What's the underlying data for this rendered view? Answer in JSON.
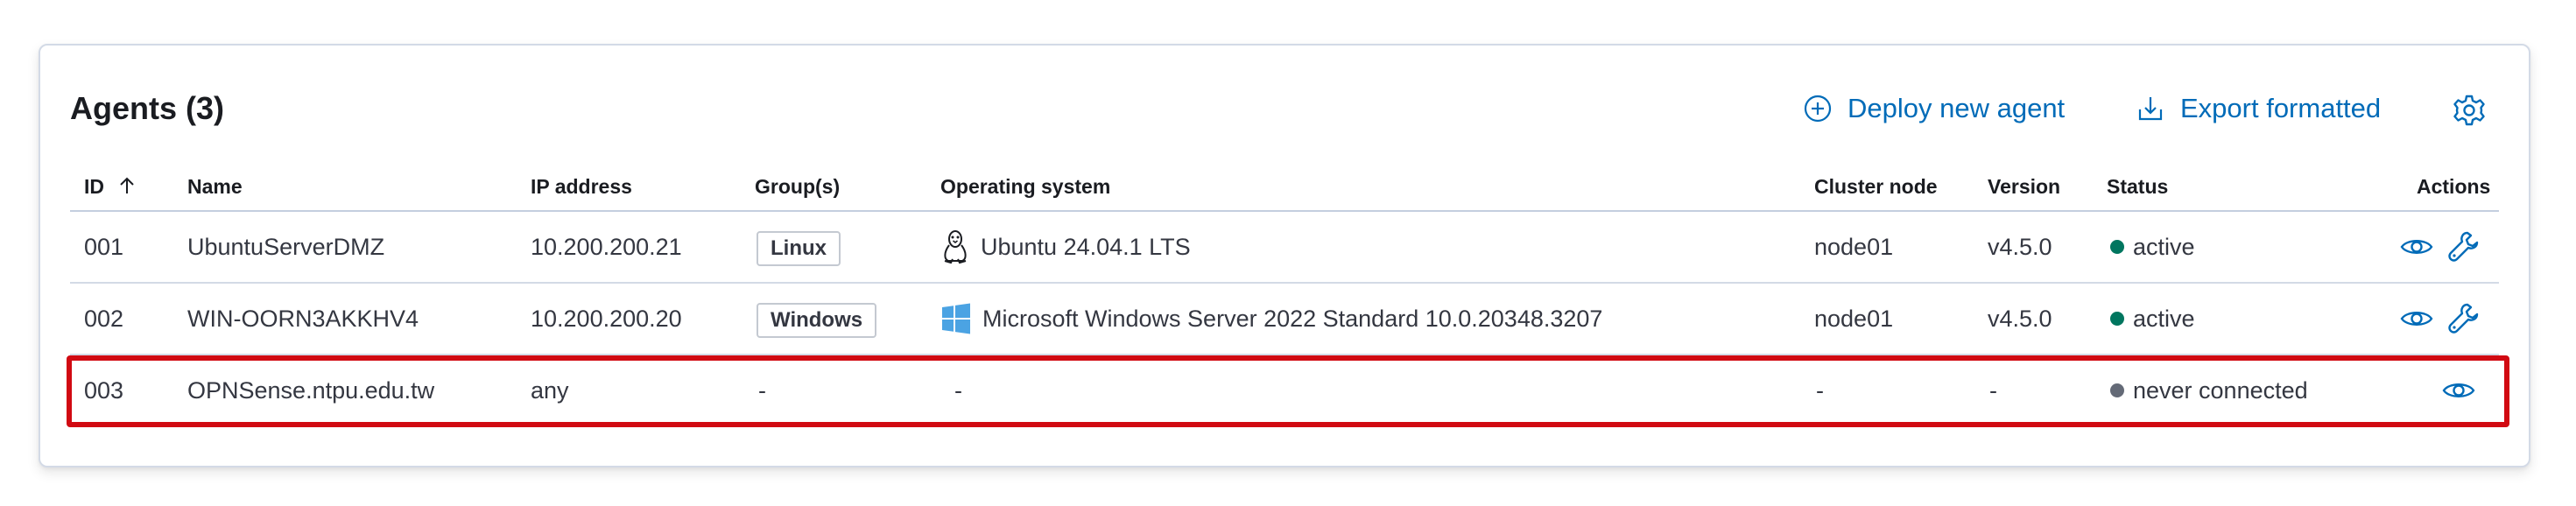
{
  "header": {
    "title": "Agents (3)",
    "deploy_label": "Deploy new agent",
    "export_label": "Export formatted"
  },
  "columns": {
    "id": "ID",
    "name": "Name",
    "ip": "IP address",
    "groups": "Group(s)",
    "os": "Operating system",
    "cluster": "Cluster node",
    "version": "Version",
    "status": "Status",
    "actions": "Actions"
  },
  "sort": {
    "column": "ID",
    "direction": "ascending"
  },
  "rows": [
    {
      "id": "001",
      "name": "UbuntuServerDMZ",
      "ip": "10.200.200.21",
      "group": "Linux",
      "os_icon": "linux-tux-icon",
      "os": "Ubuntu 24.04.1 LTS",
      "cluster": "node01",
      "version": "v4.5.0",
      "status": "active",
      "status_color": "#00765f",
      "actions": [
        "eye-icon",
        "wrench-icon"
      ]
    },
    {
      "id": "002",
      "name": "WIN-OORN3AKKHV4",
      "ip": "10.200.200.20",
      "group": "Windows",
      "os_icon": "windows-logo-icon",
      "os": "Microsoft Windows Server 2022 Standard 10.0.20348.3207",
      "cluster": "node01",
      "version": "v4.5.0",
      "status": "active",
      "status_color": "#00765f",
      "actions": [
        "eye-icon",
        "wrench-icon"
      ]
    },
    {
      "id": "003",
      "name": "OPNSense.ntpu.edu.tw",
      "ip": "any",
      "group": "-",
      "os_icon": "",
      "os": "-",
      "cluster": "-",
      "version": "-",
      "status": "never connected",
      "status_color": "#646a77",
      "actions": [
        "eye-icon"
      ],
      "highlighted": true
    }
  ],
  "colors": {
    "accent": "#006bb8",
    "highlight_border": "#d10a12",
    "active": "#00765f",
    "never_connected": "#646a77"
  }
}
